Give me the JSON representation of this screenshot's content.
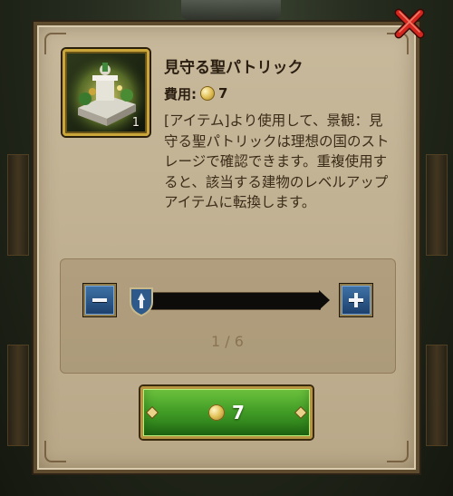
{
  "item": {
    "title": "見守る聖パトリック",
    "quantity": "1",
    "icon": "statue-monument-icon"
  },
  "cost": {
    "label": "費用:",
    "amount": "7",
    "icon": "gold-coin-icon"
  },
  "description": "[アイテム]より使用して、景観：見守る聖パトリックは理想の国のストレージで確認できます。重複使用すると、該当する建物のレベルアップアイテムに転換します。",
  "slider": {
    "current": 1,
    "max": 6,
    "ratio_text": "1 / 6"
  },
  "buy_button": {
    "amount": "7",
    "icon": "gold-coin-icon"
  },
  "colors": {
    "panel": "#c8b99c",
    "frame": "#5e4a2c",
    "button_green": "#3f9a25",
    "stepper_blue": "#2a5a8f",
    "close_red": "#d2261e"
  }
}
